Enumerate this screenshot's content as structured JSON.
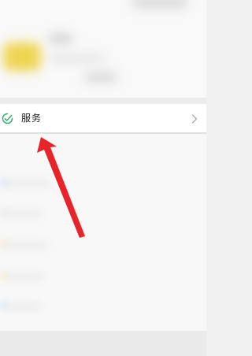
{
  "services_row": {
    "label": "服务",
    "icon": "wechat-pay-check-icon",
    "chevron_icon": "chevron-right-icon"
  },
  "colors": {
    "services_icon": "#2aae67",
    "annotation_arrow": "#e8242a",
    "avatar": "#eed552"
  }
}
